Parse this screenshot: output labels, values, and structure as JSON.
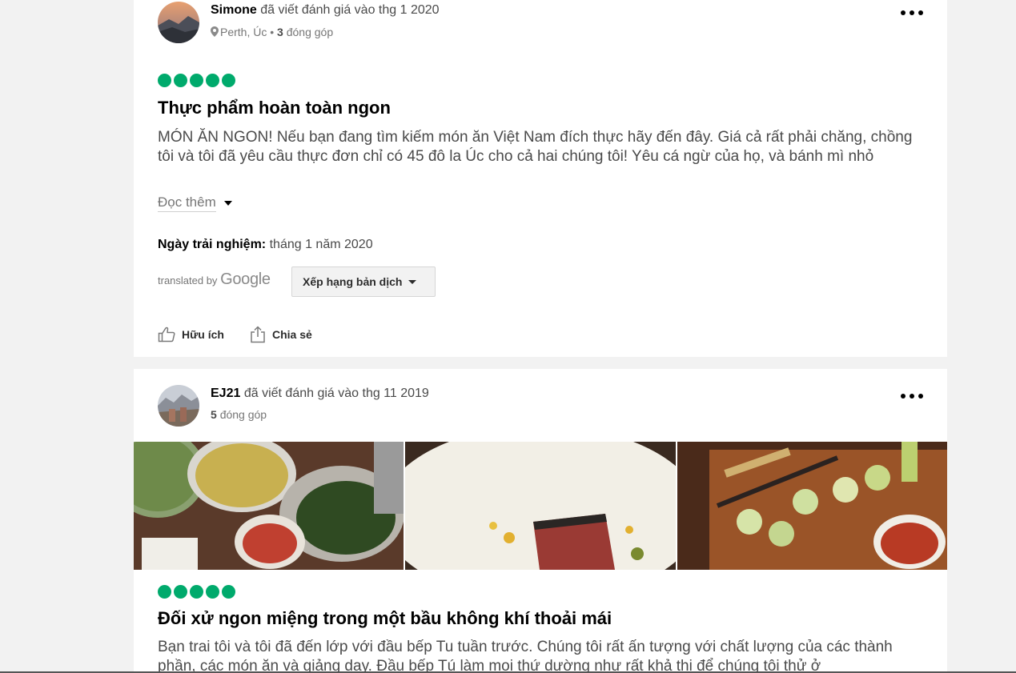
{
  "reviews": [
    {
      "author": "Simone",
      "wrote_text": "đã viết đánh giá vào thg 1 2020",
      "location": "Perth, Úc",
      "separator": "•",
      "contributions_count": "3",
      "contributions_label": "đóng góp",
      "rating": 5,
      "title": "Thực phẩm hoàn toàn ngon",
      "body": "MÓN ĂN NGON! Nếu bạn đang tìm kiếm món ăn Việt Nam đích thực hãy đến đây. Giá cả rất phải chăng, chồng tôi và tôi đã yêu cầu thực đơn chỉ có 45 đô la Úc cho cả hai chúng tôi! Yêu cá ngừ của họ, và bánh mì nhỏ",
      "read_more": "Đọc thêm",
      "date_label": "Ngày trải nghiệm:",
      "date_value": "tháng 1 năm 2020",
      "translated_by": "translated by",
      "google": "Google",
      "rate_translation": "Xếp hạng bản dịch",
      "helpful": "Hữu ích",
      "share": "Chia sẻ"
    },
    {
      "author": "EJ21",
      "wrote_text": "đã viết đánh giá vào thg 11 2019",
      "contributions_count": "5",
      "contributions_label": "đóng góp",
      "rating": 5,
      "title": "Đối xử ngon miệng trong một bầu không khí thoải mái",
      "body": "Bạn trai tôi và tôi đã đến lớp với đầu bếp Tu tuần trước. Chúng tôi rất ấn tượng với chất lượng của các thành phần, các món ăn và giảng dạy. Đầu bếp Tú làm mọi thứ dường như rất khả thi để chúng tôi thử ở",
      "photos": [
        "herb-bowls-photo",
        "seared-tuna-photo",
        "spring-rolls-photo"
      ]
    }
  ],
  "colors": {
    "rating_green": "#00aa6c",
    "page_bg": "#f2f2f2"
  },
  "icons": [
    "more-options-icon",
    "location-pin-icon",
    "thumbs-up-icon",
    "share-icon",
    "caret-down-icon"
  ]
}
